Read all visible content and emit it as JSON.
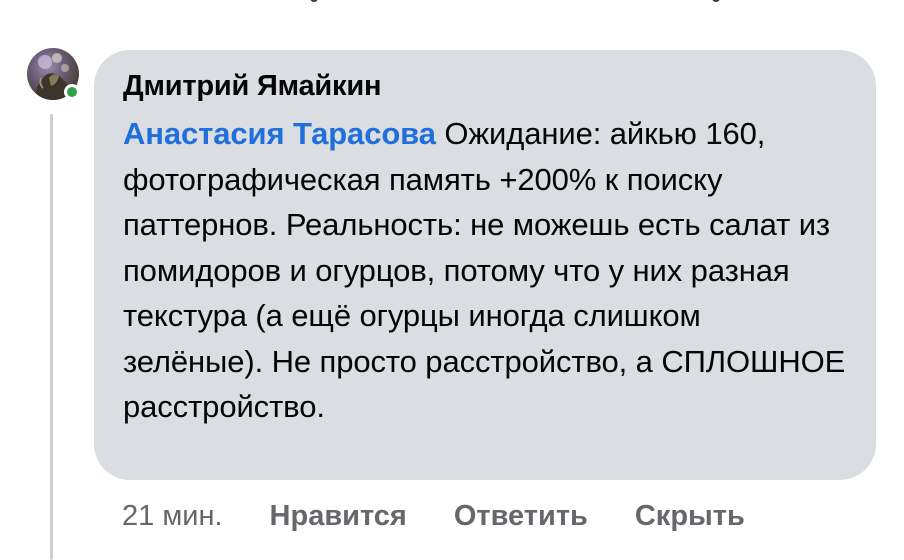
{
  "comment": {
    "author": "Дмитрий Ямайкин",
    "mention": "Анастасия Тарасова",
    "text": " Ожидание: айкью 160, фотографическая память +200% к поиску паттернов. Реальность: не можешь есть салат из помидоров и огурцов, потому что у них разная текстура (а ещё огурцы иногда слишком зелёные). Не просто расстройство, а СПЛОШНОЕ расстройство.",
    "timestamp": "21 мин.",
    "actions": {
      "like": "Нравится",
      "reply": "Ответить",
      "hide": "Скрыть"
    },
    "online": true
  },
  "icons": {
    "avatar": "user-avatar",
    "status": "online-status-dot"
  },
  "colors": {
    "bubble_bg": "#dadde1",
    "mention": "#216fdb",
    "meta_text": "#65676b",
    "online": "#31a24c",
    "thread_line": "#ccd0d5"
  }
}
